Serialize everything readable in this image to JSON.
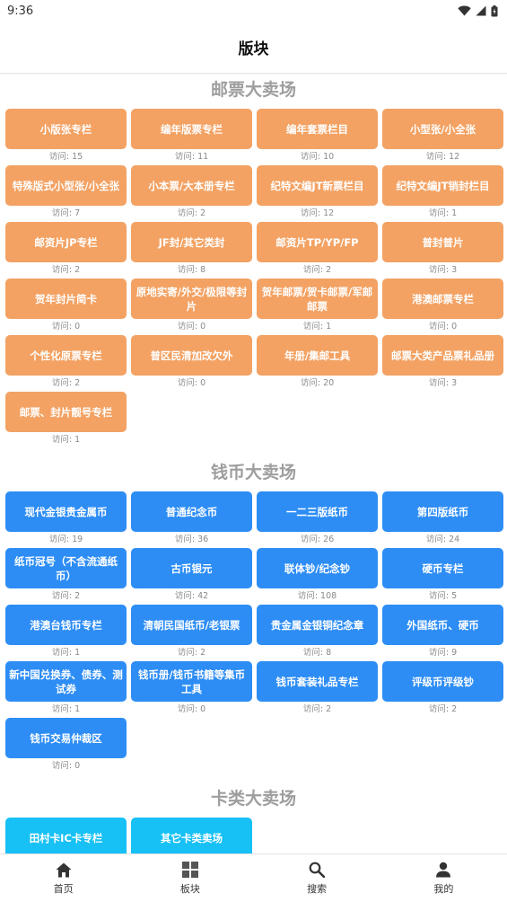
{
  "status": {
    "time": "9:36"
  },
  "header": {
    "title": "版块"
  },
  "sections": [
    {
      "title": "邮票大卖场",
      "color": "orange",
      "items": [
        {
          "label": "小版张专栏",
          "visits": "访问: 15"
        },
        {
          "label": "编年版票专栏",
          "visits": "访问: 11"
        },
        {
          "label": "编年套票栏目",
          "visits": "访问: 10"
        },
        {
          "label": "小型张/小全张",
          "visits": "访问: 12"
        },
        {
          "label": "特殊版式小型张/小全张",
          "visits": "访问: 7"
        },
        {
          "label": "小本票/大本册专栏",
          "visits": "访问: 2"
        },
        {
          "label": "纪特文编JT新票栏目",
          "visits": "访问: 12"
        },
        {
          "label": "纪特文编JT销封栏目",
          "visits": "访问: 1"
        },
        {
          "label": "邮资片JP专栏",
          "visits": "访问: 2"
        },
        {
          "label": "JF封/其它类封",
          "visits": "访问: 8"
        },
        {
          "label": "邮资片TP/YP/FP",
          "visits": "访问: 2"
        },
        {
          "label": "普封普片",
          "visits": "访问: 3"
        },
        {
          "label": "贺年封片简卡",
          "visits": "访问: 0"
        },
        {
          "label": "原地实寄/外交/极限等封片",
          "visits": "访问: 0"
        },
        {
          "label": "贺年邮票/贺卡邮票/军邮邮票",
          "visits": "访问: 1"
        },
        {
          "label": "港澳邮票专栏",
          "visits": "访问: 0"
        },
        {
          "label": "个性化原票专栏",
          "visits": "访问: 2"
        },
        {
          "label": "普区民清加改欠外",
          "visits": "访问: 0"
        },
        {
          "label": "年册/集邮工具",
          "visits": "访问: 20"
        },
        {
          "label": "邮票大类产品票礼品册",
          "visits": "访问: 3"
        },
        {
          "label": "邮票、封片靓号专栏",
          "visits": "访问: 1"
        }
      ]
    },
    {
      "title": "钱币大卖场",
      "color": "blue",
      "items": [
        {
          "label": "现代金银贵金属币",
          "visits": "访问: 19"
        },
        {
          "label": "普通纪念币",
          "visits": "访问: 36"
        },
        {
          "label": "一二三版纸币",
          "visits": "访问: 26"
        },
        {
          "label": "第四版纸币",
          "visits": "访问: 24"
        },
        {
          "label": "纸币冠号（不含流通纸币）",
          "visits": "访问: 2"
        },
        {
          "label": "古币银元",
          "visits": "访问: 42"
        },
        {
          "label": "联体钞/纪念钞",
          "visits": "访问: 108"
        },
        {
          "label": "硬币专栏",
          "visits": "访问: 5"
        },
        {
          "label": "港澳台钱币专栏",
          "visits": "访问: 1"
        },
        {
          "label": "清朝民国纸币/老银票",
          "visits": "访问: 2"
        },
        {
          "label": "贵金属金银铜纪念章",
          "visits": "访问: 8"
        },
        {
          "label": "外国纸币、硬币",
          "visits": "访问: 9"
        },
        {
          "label": "新中国兑换券、债券、测试券",
          "visits": "访问: 1"
        },
        {
          "label": "钱币册/钱币书籍等集币工具",
          "visits": "访问: 0"
        },
        {
          "label": "钱币套装礼品专栏",
          "visits": "访问: 2"
        },
        {
          "label": "评级币评级钞",
          "visits": "访问: 2"
        },
        {
          "label": "钱币交易仲裁区",
          "visits": "访问: 0"
        }
      ]
    },
    {
      "title": "卡类大卖场",
      "color": "cyan",
      "items": [
        {
          "label": "田村卡IC卡专栏",
          "visits": ""
        },
        {
          "label": "其它卡类卖场",
          "visits": ""
        }
      ]
    }
  ],
  "bottom_nav": [
    {
      "label": "首页",
      "icon": "home-icon"
    },
    {
      "label": "板块",
      "icon": "grid-icon"
    },
    {
      "label": "搜索",
      "icon": "search-icon"
    },
    {
      "label": "我的",
      "icon": "person-icon"
    }
  ],
  "colors": {
    "orange": "#f3a263",
    "blue": "#2d8df5",
    "cyan": "#17c0f5",
    "section_title": "#9e9e9e"
  }
}
